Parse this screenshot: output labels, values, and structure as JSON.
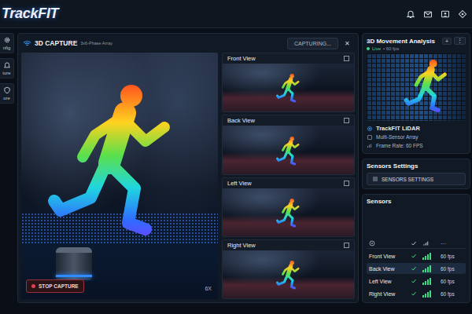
{
  "app": {
    "logo": "TrackFIT"
  },
  "sidebar": {
    "items": [
      {
        "label": "nfig"
      },
      {
        "label": "ture"
      },
      {
        "label": "ore"
      }
    ]
  },
  "capture": {
    "title": "3D CAPTURE",
    "subtitle": "3x6-Phase Array",
    "status": "CAPTURING...",
    "close": "✕",
    "stop_button": "STOP CAPTURE",
    "zoom": "6X"
  },
  "views": [
    {
      "label": "Front View"
    },
    {
      "label": "Back View"
    },
    {
      "label": "Left View"
    },
    {
      "label": "Right View"
    }
  ],
  "analysis": {
    "title": "3D Movement Analysis",
    "actions": [
      "+",
      "⋮"
    ],
    "live": "Live",
    "rate": "• 60 fps",
    "device": "TrackFIT LiDAR",
    "array": "Multi-Sensor Array",
    "frame_rate": "Frame Rate: 60 FPS"
  },
  "sensor_settings": {
    "title": "Sensors Settings",
    "button": "SENSORS SETTINGS"
  },
  "sensors": {
    "title": "Sensors",
    "more": "···",
    "rows": [
      {
        "name": "Front View",
        "ok": true,
        "level": 1,
        "fps": "60 fps",
        "selected": false
      },
      {
        "name": "Back View",
        "ok": true,
        "level": 1,
        "fps": "60 fps",
        "selected": true
      },
      {
        "name": "Left View",
        "ok": true,
        "level": 1,
        "fps": "60 fps",
        "selected": false
      },
      {
        "name": "Right View",
        "ok": true,
        "level": 1,
        "fps": "60 fps",
        "selected": false
      }
    ]
  }
}
